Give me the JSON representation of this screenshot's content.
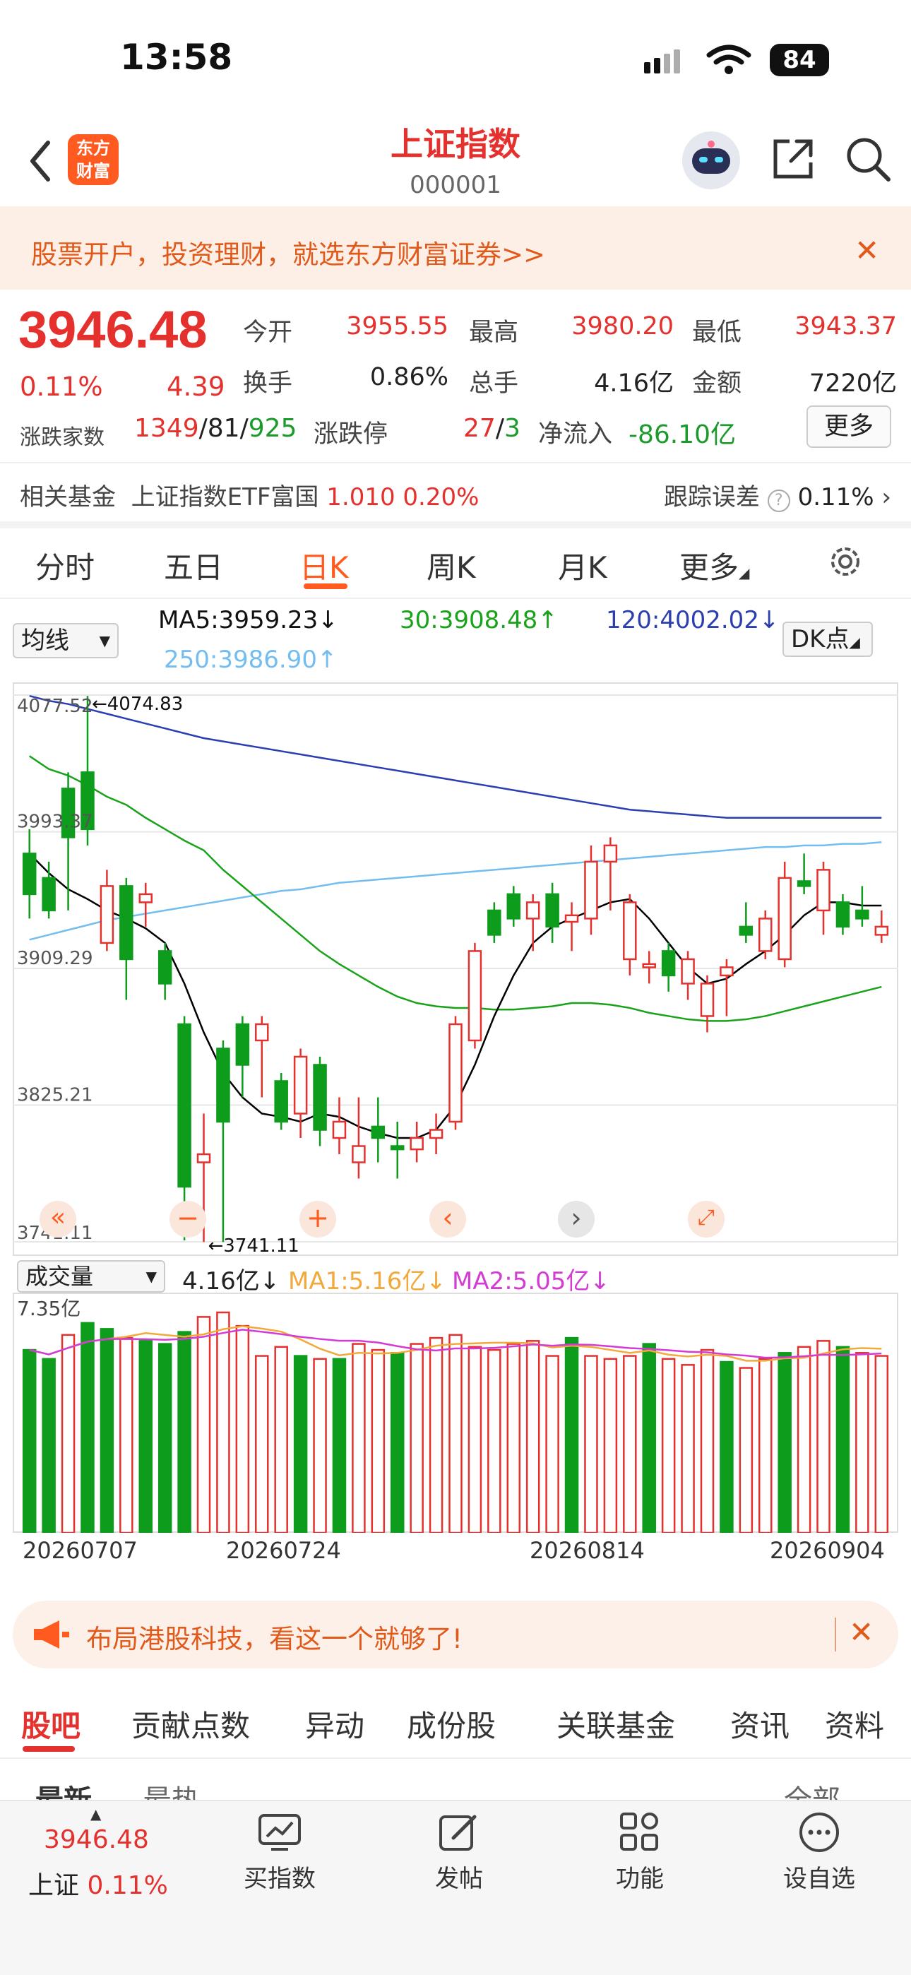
{
  "status_bar": {
    "time": "13:58",
    "battery": "84"
  },
  "header": {
    "logo_text": "东方\n财富",
    "title": "上证指数",
    "code": "000001"
  },
  "promo": {
    "text": "股票开户，投资理财，就选东方财富证券>>",
    "close": "✕"
  },
  "quote": {
    "price": "3946.48",
    "pct": "0.11%",
    "change": "4.39",
    "open_label": "今开",
    "open": "3955.55",
    "high_label": "最高",
    "high": "3980.20",
    "low_label": "最低",
    "low": "3943.37",
    "turnover_label": "换手",
    "turnover": "0.86%",
    "volume_label": "总手",
    "volume": "4.16亿",
    "amount_label": "金额",
    "amount": "7220亿",
    "adv_label": "涨跌家数",
    "adv_up": "1349",
    "adv_sep1": "/",
    "adv_flat": "81",
    "adv_sep2": "/",
    "adv_down": "925",
    "limit_label": "涨跌停",
    "limit_up": "27",
    "limit_sep": "/",
    "limit_down": "3",
    "netflow_label": "净流入",
    "netflow": "-86.10亿",
    "more_button": "更多"
  },
  "fund": {
    "label": "相关基金",
    "name": "上证指数ETF富国",
    "price": "1.010",
    "pct": "0.20%",
    "track_label": "跟踪误差",
    "track_value": "0.11%"
  },
  "tabs": [
    "分时",
    "五日",
    "日K",
    "周K",
    "月K",
    "更多"
  ],
  "ma_row": {
    "select": "均线",
    "ma5": "MA5:3959.23↓",
    "ma30": "30:3908.48↑",
    "ma120": "120:4002.02↓",
    "ma250": "250:3986.90↑",
    "dk": "DK点"
  },
  "colors": {
    "up": "#e5312e",
    "down": "#0d9c1c",
    "ma5": "#000000",
    "ma30": "#1aa31a",
    "ma120": "#2c3fb0",
    "ma250": "#74bdf0",
    "vma1": "#f2a93b",
    "vma2": "#d43bd4"
  },
  "chart_data": [
    {
      "type": "candlestick",
      "y_ticks": [
        "4077.52",
        "3993.37",
        "3909.29",
        "3825.21",
        "3741.11"
      ],
      "annotations": {
        "max_label": "4074.83",
        "min_label": "3741.11"
      },
      "ylim": [
        3741.11,
        4077.52
      ],
      "candles": [
        [
          3980,
          3955,
          3995,
          3940
        ],
        [
          3965,
          3945,
          3975,
          3940
        ],
        [
          4020,
          3990,
          4030,
          3945
        ],
        [
          4030,
          3995,
          4077,
          3985
        ],
        [
          3925,
          3960,
          3970,
          3920
        ],
        [
          3960,
          3915,
          3965,
          3890
        ],
        [
          3950,
          3955,
          3962,
          3935
        ],
        [
          3920,
          3900,
          3925,
          3890
        ],
        [
          3875,
          3775,
          3880,
          3742
        ],
        [
          3790,
          3795,
          3820,
          3741
        ],
        [
          3860,
          3815,
          3865,
          3741
        ],
        [
          3875,
          3850,
          3880,
          3830
        ],
        [
          3865,
          3875,
          3880,
          3830
        ],
        [
          3840,
          3815,
          3845,
          3810
        ],
        [
          3820,
          3855,
          3860,
          3805
        ],
        [
          3850,
          3810,
          3855,
          3800
        ],
        [
          3805,
          3815,
          3830,
          3795
        ],
        [
          3790,
          3800,
          3830,
          3780
        ],
        [
          3812,
          3805,
          3830,
          3790
        ],
        [
          3800,
          3798,
          3815,
          3780
        ],
        [
          3798,
          3805,
          3815,
          3790
        ],
        [
          3805,
          3810,
          3820,
          3795
        ],
        [
          3815,
          3875,
          3880,
          3810
        ],
        [
          3865,
          3920,
          3925,
          3860
        ],
        [
          3945,
          3930,
          3950,
          3925
        ],
        [
          3955,
          3940,
          3960,
          3935
        ],
        [
          3940,
          3950,
          3955,
          3920
        ],
        [
          3955,
          3935,
          3962,
          3925
        ],
        [
          3938,
          3942,
          3950,
          3920
        ],
        [
          3940,
          3975,
          3985,
          3930
        ],
        [
          3975,
          3985,
          3990,
          3945
        ],
        [
          3915,
          3950,
          3955,
          3905
        ],
        [
          3910,
          3912,
          3920,
          3900
        ],
        [
          3920,
          3905,
          3925,
          3895
        ],
        [
          3900,
          3915,
          3920,
          3890
        ],
        [
          3880,
          3900,
          3905,
          3870
        ],
        [
          3905,
          3910,
          3915,
          3880
        ],
        [
          3935,
          3930,
          3950,
          3925
        ],
        [
          3920,
          3940,
          3945,
          3915
        ],
        [
          3915,
          3965,
          3975,
          3910
        ],
        [
          3963,
          3960,
          3980,
          3955
        ],
        [
          3945,
          3970,
          3975,
          3930
        ],
        [
          3950,
          3935,
          3955,
          3930
        ],
        [
          3945,
          3940,
          3960,
          3935
        ],
        [
          3930,
          3935,
          3945,
          3925
        ]
      ],
      "volumes": [
        [
          6.1,
          0
        ],
        [
          5.8,
          0
        ],
        [
          6.6,
          1
        ],
        [
          7.0,
          0
        ],
        [
          6.8,
          0
        ],
        [
          6.5,
          1
        ],
        [
          6.4,
          0
        ],
        [
          6.3,
          0
        ],
        [
          6.7,
          0
        ],
        [
          7.2,
          1
        ],
        [
          7.35,
          1
        ],
        [
          6.9,
          1
        ],
        [
          5.9,
          1
        ],
        [
          6.2,
          1
        ],
        [
          5.9,
          0
        ],
        [
          5.8,
          1
        ],
        [
          5.8,
          0
        ],
        [
          6.3,
          1
        ],
        [
          6.1,
          1
        ],
        [
          6.0,
          0
        ],
        [
          6.3,
          1
        ],
        [
          6.5,
          1
        ],
        [
          6.6,
          1
        ],
        [
          6.2,
          1
        ],
        [
          6.1,
          1
        ],
        [
          6.3,
          1
        ],
        [
          6.4,
          1
        ],
        [
          5.9,
          1
        ],
        [
          6.5,
          0
        ],
        [
          5.9,
          1
        ],
        [
          5.8,
          1
        ],
        [
          5.9,
          1
        ],
        [
          6.3,
          0
        ],
        [
          5.8,
          1
        ],
        [
          5.6,
          1
        ],
        [
          6.1,
          1
        ],
        [
          5.7,
          0
        ],
        [
          5.5,
          1
        ],
        [
          5.8,
          1
        ],
        [
          6.0,
          0
        ],
        [
          6.2,
          1
        ],
        [
          6.4,
          1
        ],
        [
          6.2,
          0
        ],
        [
          6.0,
          1
        ],
        [
          5.9,
          1
        ]
      ],
      "ma_lines": {
        "ma5": [
          3980,
          3968,
          3958,
          3952,
          3945,
          3940,
          3934,
          3925,
          3900,
          3870,
          3845,
          3830,
          3820,
          3818,
          3815,
          3820,
          3818,
          3812,
          3808,
          3805,
          3805,
          3810,
          3825,
          3850,
          3880,
          3905,
          3925,
          3935,
          3940,
          3945,
          3950,
          3952,
          3940,
          3925,
          3910,
          3900,
          3903,
          3912,
          3920,
          3930,
          3942,
          3950,
          3950,
          3948,
          3948
        ],
        "ma30": [
          4040,
          4032,
          4028,
          4022,
          4015,
          4010,
          4002,
          3995,
          3988,
          3982,
          3970,
          3960,
          3950,
          3940,
          3930,
          3920,
          3912,
          3905,
          3898,
          3892,
          3888,
          3886,
          3885,
          3885,
          3884,
          3884,
          3885,
          3886,
          3888,
          3888,
          3887,
          3885,
          3882,
          3880,
          3878,
          3877,
          3877,
          3878,
          3880,
          3883,
          3886,
          3889,
          3892,
          3895,
          3898
        ],
        "ma120": [
          4077,
          4074,
          4072,
          4069,
          4066,
          4063,
          4060,
          4057,
          4054,
          4051,
          4049,
          4047,
          4045,
          4043,
          4041,
          4039,
          4037,
          4035,
          4033,
          4031,
          4029,
          4027,
          4025,
          4023,
          4021,
          4019,
          4017,
          4015,
          4013,
          4011,
          4009,
          4007,
          4006,
          4005,
          4004,
          4003,
          4002,
          4002,
          4002,
          4002,
          4002,
          4002,
          4002,
          4002,
          4002
        ],
        "ma250": [
          3927,
          3930,
          3933,
          3936,
          3939,
          3941,
          3943,
          3945,
          3947,
          3949,
          3951,
          3953,
          3955,
          3957,
          3958,
          3960,
          3962,
          3963,
          3964,
          3965,
          3966,
          3967,
          3968,
          3969,
          3970,
          3971,
          3972,
          3973,
          3974,
          3975,
          3976,
          3977,
          3978,
          3979,
          3980,
          3981,
          3982,
          3983,
          3984,
          3984,
          3985,
          3985,
          3986,
          3986,
          3987
        ]
      }
    }
  ],
  "volume_panel": {
    "select": "成交量",
    "vol": "4.16亿↓",
    "ma1": "MA1:5.16亿↓",
    "ma2": "MA2:5.05亿↓",
    "max_label": "7.35亿"
  },
  "dates": [
    "20260707",
    "20260724",
    "20260814",
    "20260904"
  ],
  "ad": {
    "text": "布局港股科技，看这一个就够了!",
    "close": "✕"
  },
  "bottom_tabs": [
    "股吧",
    "贡献点数",
    "异动",
    "成份股",
    "关联基金",
    "资讯",
    "资料"
  ],
  "sub_row": {
    "left": "最新",
    "mid": "最热",
    "right": "全部"
  },
  "toolbar": {
    "price": "3946.48",
    "name": "上证",
    "pct": "0.11%",
    "items": [
      "买指数",
      "发帖",
      "功能",
      "设自选"
    ]
  }
}
